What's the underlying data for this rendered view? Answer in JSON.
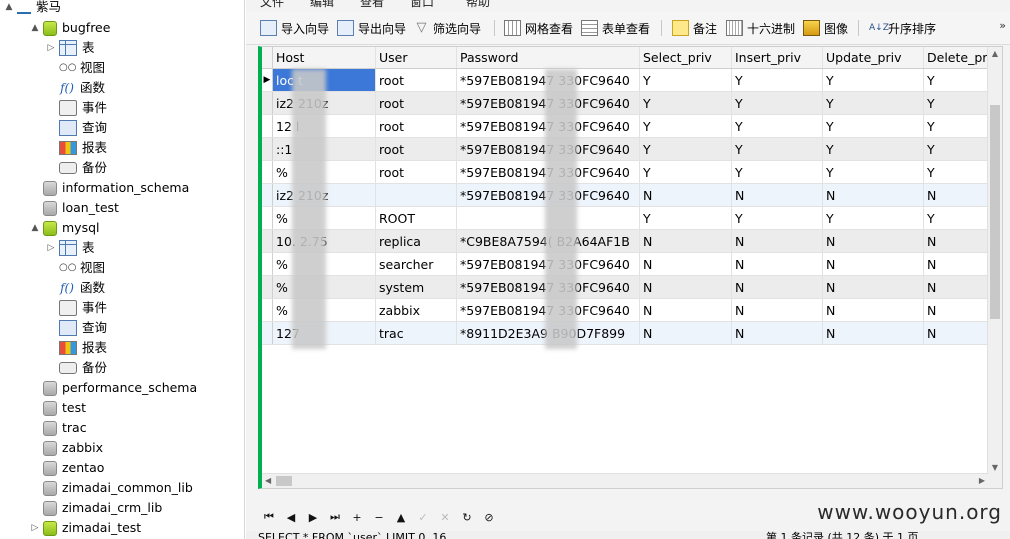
{
  "tree": {
    "connection": "紫马",
    "items": [
      {
        "label": "bugfree",
        "kind": "db-open",
        "depth": 1,
        "arrow": "▲"
      },
      {
        "label": "表",
        "kind": "table",
        "depth": 2,
        "arrow": "▷"
      },
      {
        "label": "视图",
        "kind": "view",
        "depth": 2,
        "arrow": ""
      },
      {
        "label": "函数",
        "kind": "function",
        "depth": 2,
        "arrow": ""
      },
      {
        "label": "事件",
        "kind": "event",
        "depth": 2,
        "arrow": ""
      },
      {
        "label": "查询",
        "kind": "query",
        "depth": 2,
        "arrow": ""
      },
      {
        "label": "报表",
        "kind": "report",
        "depth": 2,
        "arrow": ""
      },
      {
        "label": "备份",
        "kind": "backup",
        "depth": 2,
        "arrow": ""
      },
      {
        "label": "information_schema",
        "kind": "db",
        "depth": 1,
        "arrow": ""
      },
      {
        "label": "loan_test",
        "kind": "db",
        "depth": 1,
        "arrow": ""
      },
      {
        "label": "mysql",
        "kind": "db-open",
        "depth": 1,
        "arrow": "▲"
      },
      {
        "label": "表",
        "kind": "table",
        "depth": 2,
        "arrow": "▷"
      },
      {
        "label": "视图",
        "kind": "view",
        "depth": 2,
        "arrow": ""
      },
      {
        "label": "函数",
        "kind": "function",
        "depth": 2,
        "arrow": ""
      },
      {
        "label": "事件",
        "kind": "event",
        "depth": 2,
        "arrow": ""
      },
      {
        "label": "查询",
        "kind": "query",
        "depth": 2,
        "arrow": ""
      },
      {
        "label": "报表",
        "kind": "report",
        "depth": 2,
        "arrow": ""
      },
      {
        "label": "备份",
        "kind": "backup",
        "depth": 2,
        "arrow": ""
      },
      {
        "label": "performance_schema",
        "kind": "db",
        "depth": 1,
        "arrow": ""
      },
      {
        "label": "test",
        "kind": "db",
        "depth": 1,
        "arrow": ""
      },
      {
        "label": "trac",
        "kind": "db",
        "depth": 1,
        "arrow": ""
      },
      {
        "label": "zabbix",
        "kind": "db",
        "depth": 1,
        "arrow": ""
      },
      {
        "label": "zentao",
        "kind": "db",
        "depth": 1,
        "arrow": ""
      },
      {
        "label": "zimadai_common_lib",
        "kind": "db",
        "depth": 1,
        "arrow": ""
      },
      {
        "label": "zimadai_crm_lib",
        "kind": "db",
        "depth": 1,
        "arrow": ""
      },
      {
        "label": "zimadai_test",
        "kind": "db-open",
        "depth": 1,
        "arrow": "▷"
      }
    ]
  },
  "menubar": [
    "文件",
    "编辑",
    "查看",
    "窗口",
    "帮助"
  ],
  "toolbar": {
    "import": "导入向导",
    "export": "导出向导",
    "filter": "筛选向导",
    "grid_view": "网格查看",
    "form_view": "表单查看",
    "memo": "备注",
    "hex": "十六进制",
    "image": "图像",
    "sort_asc": "升序排序",
    "sort_icon_text": "A↓Z",
    "more": "»"
  },
  "grid": {
    "columns": [
      "Host",
      "User",
      "Password",
      "Select_priv",
      "Insert_priv",
      "Update_priv",
      "Delete_priv"
    ],
    "rows": [
      [
        "loc    t",
        "root",
        "*597EB081947       330FC9640",
        "Y",
        "Y",
        "Y",
        "Y"
      ],
      [
        "iz2      210z",
        "root",
        "*597EB081947       330FC9640",
        "Y",
        "Y",
        "Y",
        "Y"
      ],
      [
        "12      l",
        "root",
        "*597EB081947       330FC9640",
        "Y",
        "Y",
        "Y",
        "Y"
      ],
      [
        "::1",
        "root",
        "*597EB081947       330FC9640",
        "Y",
        "Y",
        "Y",
        "Y"
      ],
      [
        "%",
        "root",
        "*597EB081947       330FC9640",
        "Y",
        "Y",
        "Y",
        "Y"
      ],
      [
        "iz2      210z",
        "",
        "*597EB081947       330FC9640",
        "N",
        "N",
        "N",
        "N"
      ],
      [
        "%",
        "ROOT",
        "",
        "Y",
        "Y",
        "Y",
        "Y"
      ],
      [
        "10.      2.75",
        "replica",
        "*C9BE8A7594(      B2A64AF1B",
        "N",
        "N",
        "N",
        "N"
      ],
      [
        "%",
        "searcher",
        "*597EB081947       330FC9640",
        "N",
        "N",
        "N",
        "N"
      ],
      [
        "%",
        "system",
        "*597EB081947       330FC9640",
        "N",
        "N",
        "N",
        "N"
      ],
      [
        "%",
        "zabbix",
        "*597EB081947       330FC9640",
        "N",
        "N",
        "N",
        "N"
      ],
      [
        "127      ",
        "trac",
        "*8911D2E3A9       B90D7F899",
        "N",
        "N",
        "N",
        "N"
      ]
    ],
    "current_marker": "▶"
  },
  "navbar": [
    "⏮",
    "◀",
    "▶",
    "⏭",
    "+",
    "−",
    "▲",
    "✓",
    "✕",
    "↻",
    "⊘"
  ],
  "status": {
    "sql": "SELECT * FROM `user` LIMIT 0, 16",
    "records": "第 1 条记录 (共 12 条) 于 1 页"
  },
  "watermark": "www.wooyun.org",
  "colors": {
    "accent": "#3c78d8",
    "green_bar": "#00b050"
  }
}
